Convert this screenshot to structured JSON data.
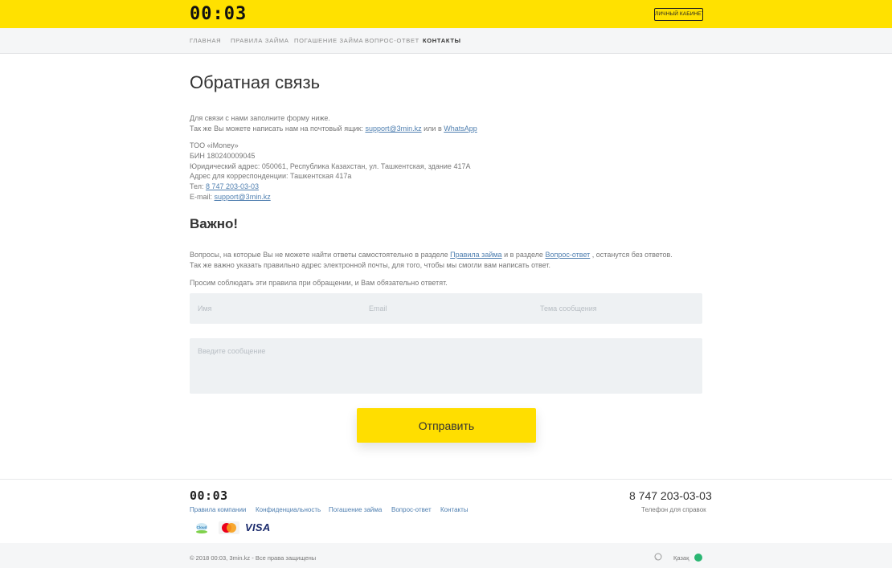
{
  "header": {
    "logo": "00:03",
    "cabinet_label": "Личный кабинет"
  },
  "nav": {
    "items": [
      {
        "label": "Главная"
      },
      {
        "label": "Правила займа"
      },
      {
        "label": "Погашение займа"
      },
      {
        "label": "Вопрос-ответ"
      },
      {
        "label": "Контакты",
        "active": true
      }
    ]
  },
  "main": {
    "title": "Обратная связь",
    "intro_line1": "Для связи с нами заполните форму ниже.",
    "intro_line2_prefix": "Так же Вы можете написать нам на почтовый ящик:",
    "intro_email": "support@3min.kz",
    "intro_or": "или в",
    "intro_whatsapp": "WhatsApp",
    "company": {
      "name": "ТОО «iMoney»",
      "bin": "БИН 180240009045",
      "legal_address": "Юридический адрес: 050061, Республика Казахстан, ул. Ташкентская, здание 417А",
      "mail_address": "Адрес для корреспонденции: Ташкентская 417а",
      "tel_label": "Тел:",
      "tel": "8 747 203-03-03",
      "email_label": "E-mail:",
      "email": "support@3min.kz"
    },
    "important_title": "Важно!",
    "important_p1_a": "Вопросы, на которые Вы не можете найти ответы самостоятельно в разделе",
    "important_p1_link1": "Правила займа",
    "important_p1_b": "и в разделе",
    "important_p1_link2": "Вопрос-ответ",
    "important_p1_c": ", останутся без ответов.",
    "important_p2": "Так же важно указать правильно адрес электронной почты, для того, чтобы мы смогли вам написать ответ.",
    "important_p3": "Просим соблюдать эти правила при обращении, и Вам обязательно ответят."
  },
  "form": {
    "name_placeholder": "Имя",
    "email_placeholder": "Email",
    "subject_placeholder": "Тема сообщения",
    "message_placeholder": "Введите сообщение",
    "submit_label": "Отправить"
  },
  "footer": {
    "logo": "00:03",
    "links": [
      {
        "label": "Правила компании"
      },
      {
        "label": "Конфиденциальность"
      },
      {
        "label": "Погашение займа"
      },
      {
        "label": "Вопрос-ответ"
      },
      {
        "label": "Контакты"
      }
    ],
    "phone": "8 747 203-03-03",
    "phone_label": "Телефон для справок",
    "payment_icons": [
      "cloud-pay-icon",
      "mastercard-icon",
      "visa-icon"
    ],
    "visa_text": "VISA",
    "copyright": "© 2018 00:03, 3min.kz - Все права защищены",
    "lang": "Қазақ"
  },
  "colors": {
    "accent": "#ffe100",
    "link": "#4f7fb0",
    "lang_dot": "#2bb673"
  }
}
